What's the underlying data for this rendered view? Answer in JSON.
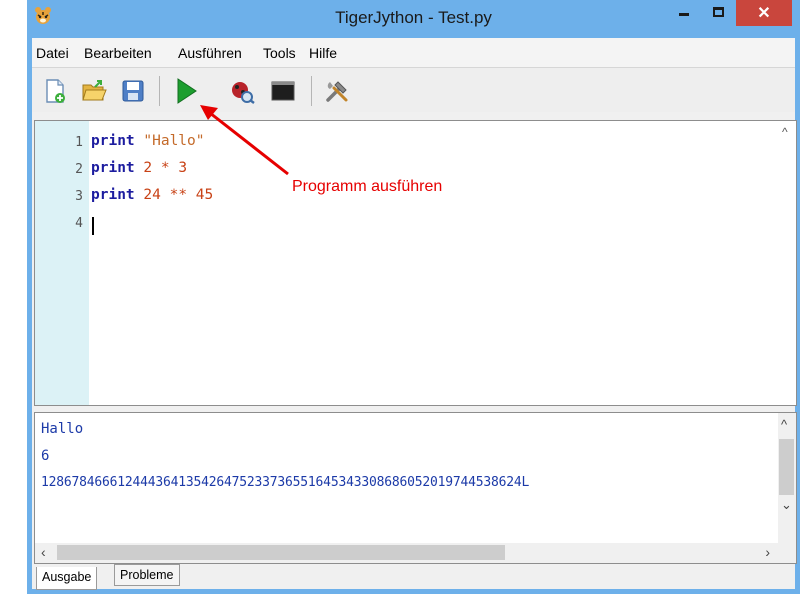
{
  "window": {
    "title": "TigerJython - Test.py",
    "colors": {
      "titlebar": "#6db0ea",
      "close": "#c9463d",
      "gutter": "#dcf2f6"
    }
  },
  "menu": [
    "Datei",
    "Bearbeiten",
    "Ausführen",
    "Tools",
    "Hilfe"
  ],
  "toolbar": {
    "icons": [
      "new-file-icon",
      "open-folder-icon",
      "save-icon",
      "run-icon",
      "debug-icon",
      "console-icon",
      "tools-icon"
    ]
  },
  "editor": {
    "line_numbers": [
      "1",
      "2",
      "3",
      "4"
    ],
    "lines": [
      {
        "kw": "print",
        "rest": " ",
        "str": "\"Hallo\""
      },
      {
        "kw": "print",
        "a": "2",
        "op": "*",
        "b": "3"
      },
      {
        "kw": "print",
        "a": "24",
        "op": "**",
        "b": "45"
      }
    ]
  },
  "annotation": {
    "text": "Programm ausführen"
  },
  "output": {
    "lines": [
      "Hallo",
      "6",
      "128678466612444364135426475233736551645343308686052019744538624L"
    ]
  },
  "tabs": [
    "Ausgabe",
    "Probleme"
  ]
}
